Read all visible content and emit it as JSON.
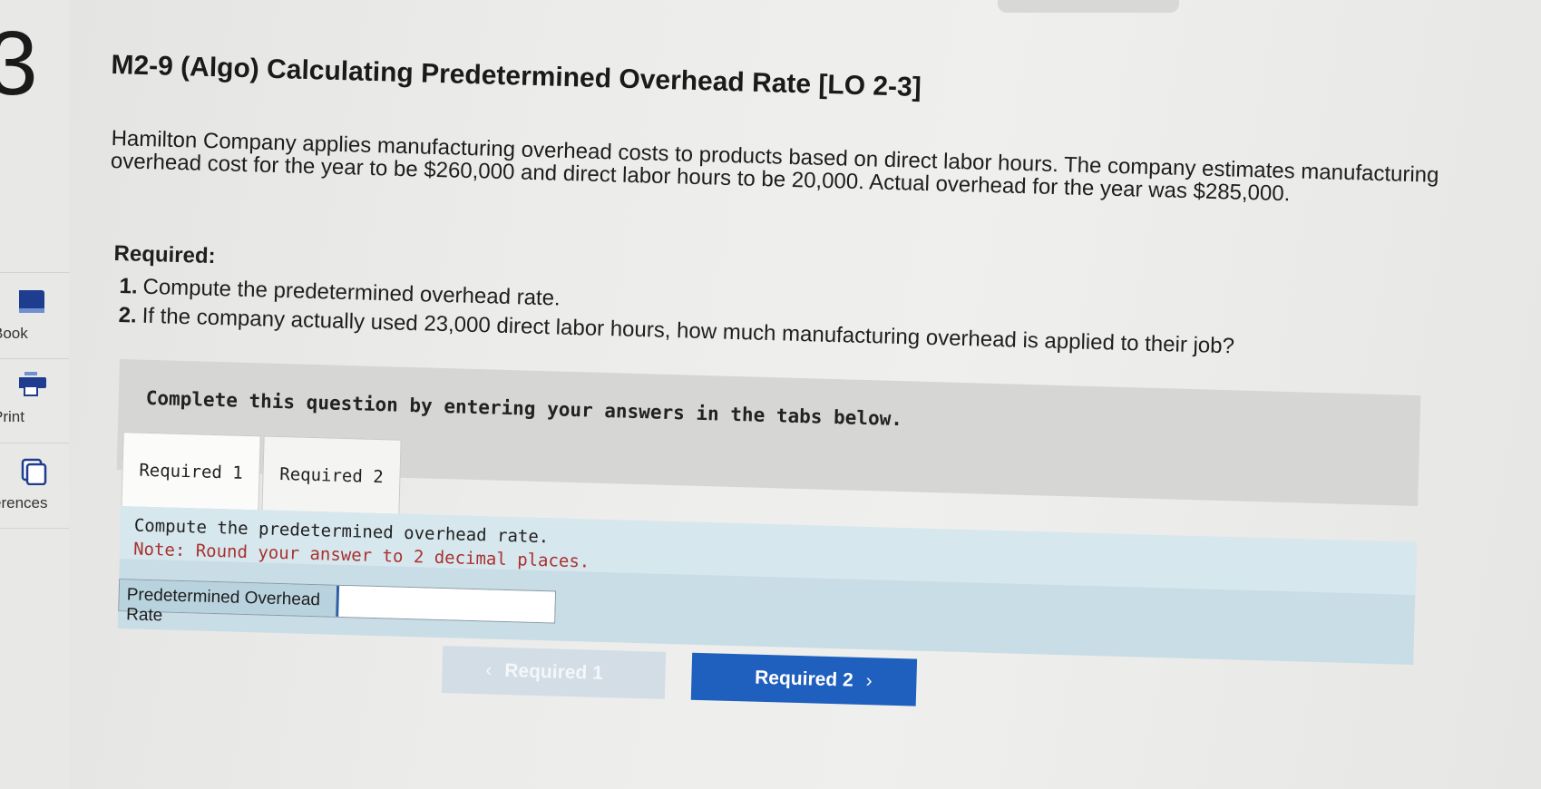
{
  "sidebar": {
    "question_number": "3",
    "items": [
      {
        "label": "Book",
        "icon": "book-icon"
      },
      {
        "label": "Print",
        "icon": "print-icon"
      },
      {
        "label": "erences",
        "icon": "references-icon"
      }
    ]
  },
  "question": {
    "title": "M2-9 (Algo) Calculating Predetermined Overhead Rate [LO 2-3]",
    "paragraph": "Hamilton Company applies manufacturing overhead costs to products based on direct labor hours. The company estimates manufacturing overhead cost for the year to be $260,000 and direct labor hours to be 20,000. Actual overhead for the year was $285,000.",
    "required_header": "Required:",
    "requirements": [
      {
        "num": "1.",
        "text": "Compute the predetermined overhead rate."
      },
      {
        "num": "2.",
        "text": "If the company actually used 23,000 direct labor hours, how much manufacturing overhead is applied to their job?"
      }
    ]
  },
  "panel": {
    "instruction": "Complete this question by entering your answers in the tabs below.",
    "tabs": [
      {
        "label": "Required 1",
        "active": true
      },
      {
        "label": "Required 2",
        "active": false
      }
    ],
    "content": {
      "prompt": "Compute the predetermined overhead rate.",
      "note": "Note: Round your answer to 2 decimal places.",
      "answer_label": "Predetermined Overhead Rate",
      "answer_value": ""
    }
  },
  "navigation": {
    "prev_label": "Required 1",
    "next_label": "Required 2"
  },
  "colors": {
    "next_button": "#1f5fbd",
    "prev_button_disabled": "#d3dde6",
    "note_text": "#a8322f",
    "content_background": "#c9dde6"
  }
}
